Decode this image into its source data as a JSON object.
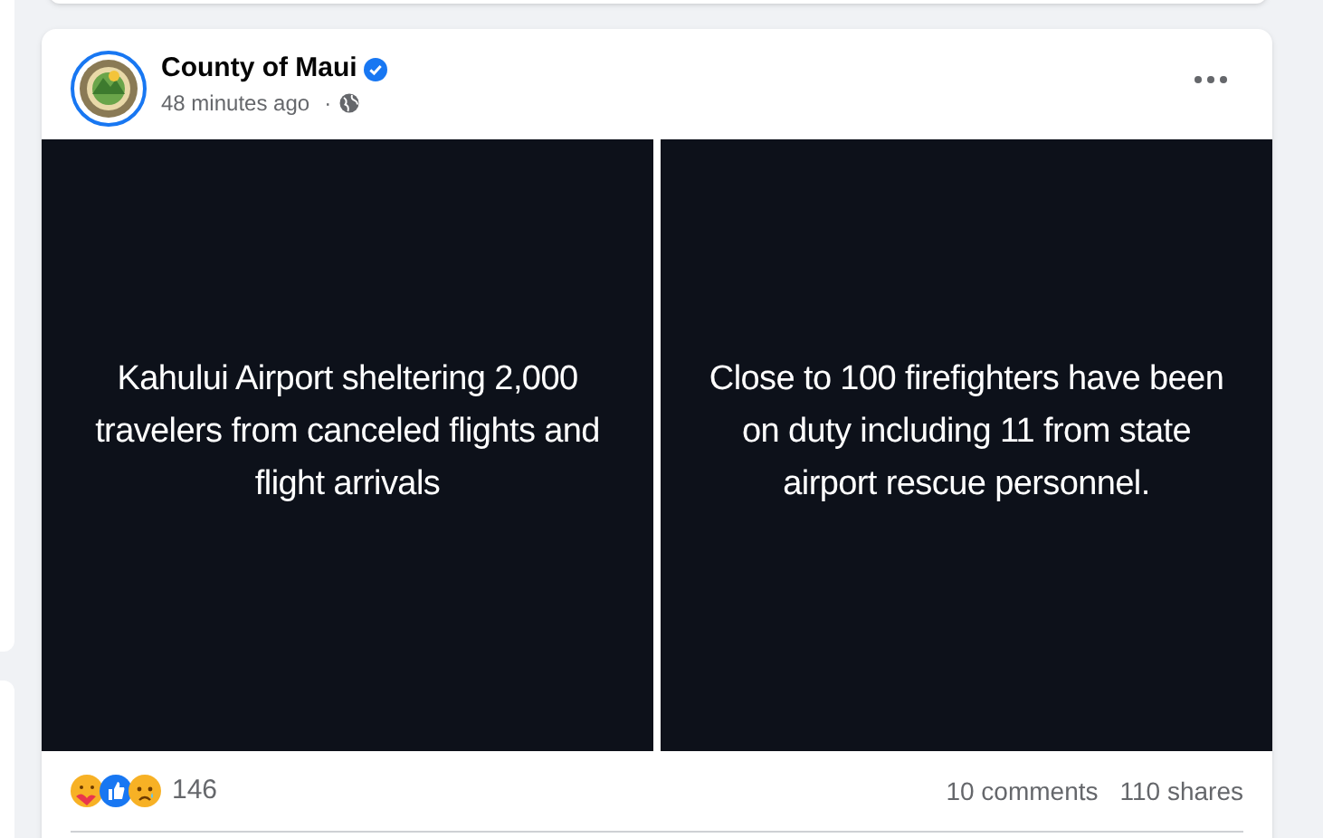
{
  "post": {
    "author": "County of Maui",
    "verified": true,
    "time": "48 minutes ago",
    "audience_separator": "·",
    "slides": [
      {
        "text": "Kahului Airport sheltering 2,000 travelers from canceled flights and flight arrivals"
      },
      {
        "text": "Close to 100 firefighters have been on duty including 11 from state airport rescue personnel."
      }
    ],
    "reactions_count": "146",
    "comments": "10 comments",
    "shares": "110 shares"
  }
}
